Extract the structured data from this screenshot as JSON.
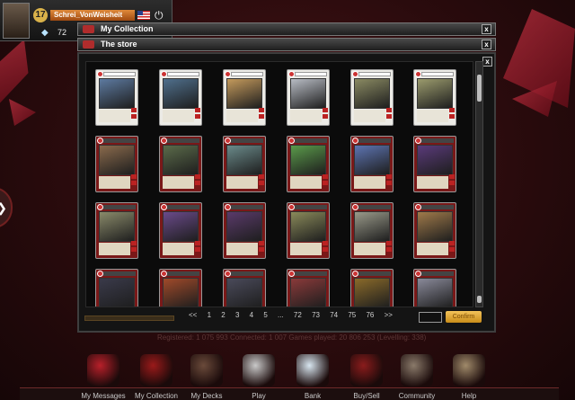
{
  "player": {
    "level": "17",
    "username": "Schrei_VonWeisheit",
    "gems": "72"
  },
  "windows": {
    "my_collection_title": "My Collection",
    "store_title": "The store",
    "close_label": "x"
  },
  "cards": [
    {
      "frame": "white",
      "art": "#5d7aa0"
    },
    {
      "frame": "white",
      "art": "#4f6f8c"
    },
    {
      "frame": "white",
      "art": "#c49a5c"
    },
    {
      "frame": "white",
      "art": "#b8bcc4"
    },
    {
      "frame": "white",
      "art": "#8a8a62"
    },
    {
      "frame": "white",
      "art": "#9b9b6d"
    },
    {
      "frame": "red",
      "art": "#8a6a4c"
    },
    {
      "frame": "red",
      "art": "#5b6b4a"
    },
    {
      "frame": "red",
      "art": "#6a8a8a"
    },
    {
      "frame": "red",
      "art": "#5a9a4a"
    },
    {
      "frame": "red",
      "art": "#5d74b2"
    },
    {
      "frame": "red",
      "art": "#5a3a7a"
    },
    {
      "frame": "red",
      "art": "#8a8a6a"
    },
    {
      "frame": "red",
      "art": "#6a4a8a"
    },
    {
      "frame": "red",
      "art": "#5a3a6a"
    },
    {
      "frame": "red",
      "art": "#8a8a5a"
    },
    {
      "frame": "red",
      "art": "#9a9a8a"
    },
    {
      "frame": "red",
      "art": "#a07a4a"
    },
    {
      "frame": "red",
      "art": "#3a3a4a"
    },
    {
      "frame": "red",
      "art": "#a04a2a"
    },
    {
      "frame": "red",
      "art": "#4a4a5a"
    },
    {
      "frame": "red",
      "art": "#8a3a3a"
    },
    {
      "frame": "red",
      "art": "#8a6a2a"
    },
    {
      "frame": "red",
      "art": "#8a8a9a"
    }
  ],
  "pagination": {
    "prev": "<<",
    "pages": [
      "1",
      "2",
      "3",
      "4",
      "5",
      "...",
      "72",
      "73",
      "74",
      "75",
      "76"
    ],
    "next": ">>",
    "confirm_label": "Confirm"
  },
  "stats_line": "Registered: 1 075 993   Connected: 1 007   Games played: 20 806 253 (Levelling: 338)",
  "bottom_nav": [
    {
      "label": "My Messages",
      "icon": "letter-icon",
      "color": "#b8202a"
    },
    {
      "label": "My Collection",
      "icon": "collection-icon",
      "color": "#9a1a1a"
    },
    {
      "label": "My Decks",
      "icon": "decks-icon",
      "color": "#6a4a3a"
    },
    {
      "label": "Play",
      "icon": "crossed-swords-icon",
      "color": "#c9c9c9"
    },
    {
      "label": "Bank",
      "icon": "diamond-icon",
      "color": "#d8e6f0"
    },
    {
      "label": "Buy/Sell",
      "icon": "market-icon",
      "color": "#8a1c1c"
    },
    {
      "label": "Community",
      "icon": "community-icon",
      "color": "#8a7a6a"
    },
    {
      "label": "Help",
      "icon": "book-icon",
      "color": "#a08a6a"
    }
  ]
}
